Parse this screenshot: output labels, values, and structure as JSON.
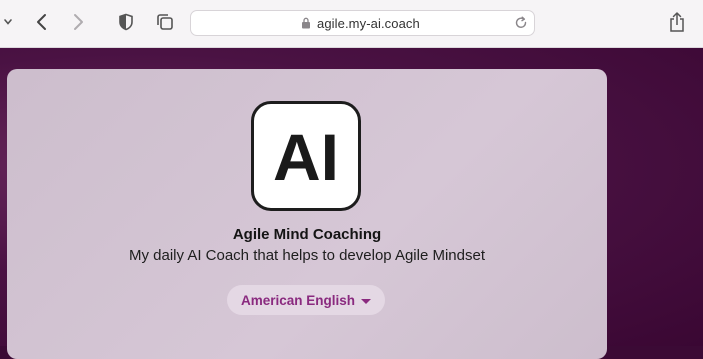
{
  "browser": {
    "address": "agile.my-ai.coach"
  },
  "app": {
    "logo_text": "AI",
    "title": "Agile Mind Coaching",
    "subtitle": "My daily AI Coach that helps to develop Agile Mindset",
    "language_selector": "American English"
  },
  "colors": {
    "background": "#3b0a35",
    "card": "#d4c4d4",
    "accent": "#8a2a7f"
  }
}
